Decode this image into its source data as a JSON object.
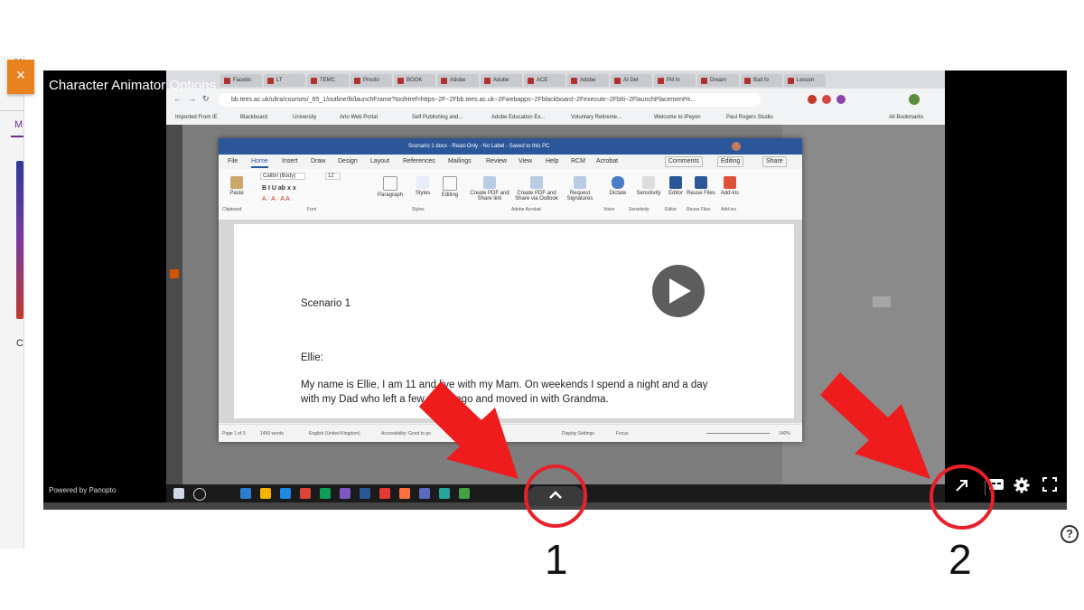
{
  "player": {
    "title": "Character Animator Options",
    "powered_by": "Powered by Panopto",
    "close_glyph": "×"
  },
  "page_strip": {
    "letters": [
      "Sl",
      "M",
      "C"
    ]
  },
  "browser": {
    "tabs": [
      "Facebo",
      "LT",
      "TEMC",
      "Proofo",
      "BOOK",
      "Adobe",
      "Adobe",
      "ACE",
      "Adobe",
      "AI Det",
      "Pill In",
      "Dream",
      "Bait fo",
      "Lesson"
    ],
    "url": "bb.tees.ac.uk/ultra/courses/_65_1/outline/lti/launchFrame?toolHref=https~2F~2Fbb.tees.ac.uk~2Fwebapps~2Fblackboard~2Fexecute~2Fblti~2FlaunchPlacement%...",
    "bookmarks": [
      "Imported From IE",
      "Blackboard",
      "University",
      "Arlo Web Portal",
      "Self Publishing and...",
      "Adobe Education Ex...",
      "Voluntary Retireme...",
      "Welcome to iPeyon",
      "Paul Rogers Studio",
      "All Bookmarks"
    ]
  },
  "word": {
    "title": "Scenario 1 docx - Read-Only - No Label - Saved to this PC",
    "menu": [
      "File",
      "Home",
      "Insert",
      "Draw",
      "Design",
      "Layout",
      "References",
      "Mailings",
      "Review",
      "View",
      "Help",
      "RCM",
      "Acrobat"
    ],
    "comments_label": "Comments",
    "editing_label": "Editing",
    "share_label": "Share",
    "ribbon_buttons": [
      "Paste",
      "Paragraph",
      "Styles",
      "Editing",
      "Create PDF and Share link",
      "Create PDF and Share via Outlook",
      "Request Signatures",
      "Dictate",
      "Sensitivity",
      "Editor",
      "Reuse Files",
      "Add-ins"
    ],
    "ribbon_groups": [
      "Clipboard",
      "Font",
      "Styles",
      "Adobe Acrobat",
      "Voice",
      "Sensitivity",
      "Editor",
      "Reuse Files",
      "Add-ins"
    ],
    "font_name": "Calibri (Body)",
    "font_size": "12",
    "doc": {
      "heading": "Scenario 1",
      "name_line": "Ellie:",
      "line1": "My name is Ellie, I am 11 and live with my Mam. On weekends I spend a night and a day",
      "line2": "with my Dad who left a few years ago and moved in with Grandma."
    },
    "status": {
      "page": "Page 1 of 3",
      "words": "1456 words",
      "language": "English (United Kingdom)",
      "accessibility": "Accessibility: Good to go",
      "display": "Display Settings",
      "focus": "Focus",
      "zoom": "140%"
    }
  },
  "annotations": {
    "label_1": "1",
    "label_2": "2",
    "arrow_color": "#ee1c1c",
    "ring_color": "#e8202a"
  },
  "colors": {
    "accent": "#e8821e",
    "word_blue": "#2b579a"
  }
}
